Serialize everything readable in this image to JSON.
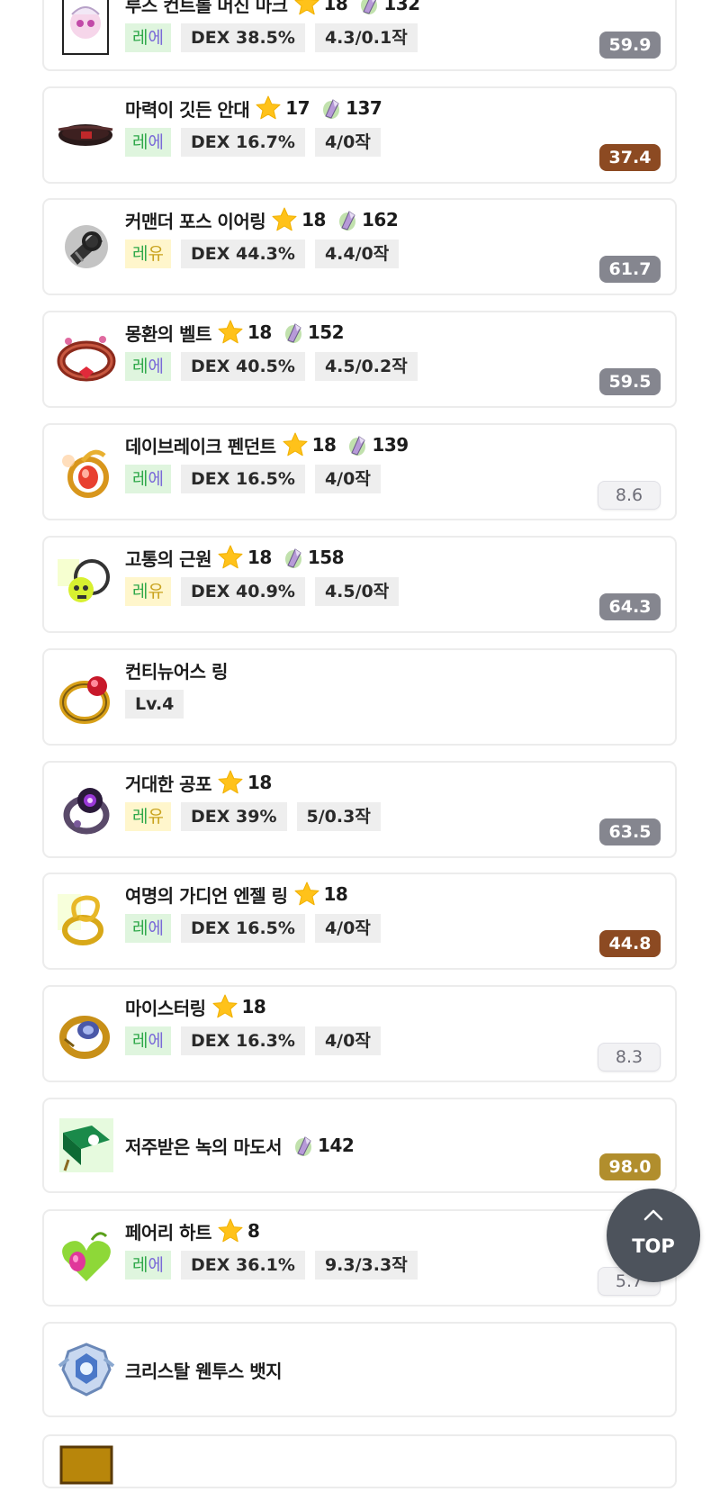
{
  "items": [
    {
      "name": "루즈 컨트롤 머신 마크",
      "star": "18",
      "gem": "132",
      "pot": [
        "레",
        "에"
      ],
      "potClass": "leg",
      "stat": "DEX 38.5%",
      "sub": "4.3/0.1작",
      "score": "59.9",
      "scoreStyle": "gray",
      "icon": "lucid-mark-icon"
    },
    {
      "name": "마력이 깃든 안대",
      "star": "17",
      "gem": "137",
      "pot": [
        "레",
        "에"
      ],
      "potClass": "leg",
      "stat": "DEX 16.7%",
      "sub": "4/0작",
      "score": "37.4",
      "scoreStyle": "brown",
      "icon": "eyepatch-icon"
    },
    {
      "name": "커맨더 포스 이어링",
      "star": "18",
      "gem": "162",
      "pot": [
        "레",
        "유"
      ],
      "potClass": "uni",
      "stat": "DEX 44.3%",
      "sub": "4.4/0작",
      "score": "61.7",
      "scoreStyle": "gray",
      "icon": "earring-icon"
    },
    {
      "name": "몽환의 벨트",
      "star": "18",
      "gem": "152",
      "pot": [
        "레",
        "에"
      ],
      "potClass": "leg",
      "stat": "DEX 40.5%",
      "sub": "4.5/0.2작",
      "score": "59.5",
      "scoreStyle": "gray",
      "icon": "belt-icon"
    },
    {
      "name": "데이브레이크 펜던트",
      "star": "18",
      "gem": "139",
      "pot": [
        "레",
        "에"
      ],
      "potClass": "leg",
      "stat": "DEX 16.5%",
      "sub": "4/0작",
      "score": "8.6",
      "scoreStyle": "light",
      "icon": "pendant-icon"
    },
    {
      "name": "고통의 근원",
      "star": "18",
      "gem": "158",
      "pot": [
        "레",
        "유"
      ],
      "potClass": "uni",
      "stat": "DEX 40.9%",
      "sub": "4.5/0작",
      "score": "64.3",
      "scoreStyle": "gray",
      "icon": "skull-pendant-icon"
    },
    {
      "name": "컨티뉴어스 링",
      "level": "Lv.4",
      "icon": "ring-icon"
    },
    {
      "name": "거대한 공포",
      "star": "18",
      "pot": [
        "레",
        "유"
      ],
      "potClass": "uni",
      "stat": "DEX 39%",
      "sub": "5/0.3작",
      "score": "63.5",
      "scoreStyle": "gray",
      "icon": "dark-ring-icon"
    },
    {
      "name": "여명의 가디언 엔젤 링",
      "star": "18",
      "pot": [
        "레",
        "에"
      ],
      "potClass": "leg",
      "stat": "DEX 16.5%",
      "sub": "4/0작",
      "score": "44.8",
      "scoreStyle": "brown",
      "icon": "angel-ring-icon"
    },
    {
      "name": "마이스터링",
      "star": "18",
      "pot": [
        "레",
        "에"
      ],
      "potClass": "leg",
      "stat": "DEX 16.3%",
      "sub": "4/0작",
      "score": "8.3",
      "scoreStyle": "light",
      "icon": "meister-ring-icon"
    },
    {
      "name": "저주받은 녹의 마도서",
      "gem": "142",
      "score": "98.0",
      "scoreStyle": "gold",
      "icon": "spellbook-icon"
    },
    {
      "name": "페어리 하트",
      "star": "8",
      "pot": [
        "레",
        "에"
      ],
      "potClass": "leg",
      "stat": "DEX 36.1%",
      "sub": "9.3/3.3작",
      "score": "5.7",
      "scoreStyle": "light",
      "icon": "fairy-heart-icon"
    },
    {
      "name": "크리스탈 웬투스 뱃지",
      "icon": "badge-icon"
    },
    {
      "name": "",
      "icon": "emblem-icon"
    }
  ],
  "top_button": {
    "label": "TOP"
  }
}
